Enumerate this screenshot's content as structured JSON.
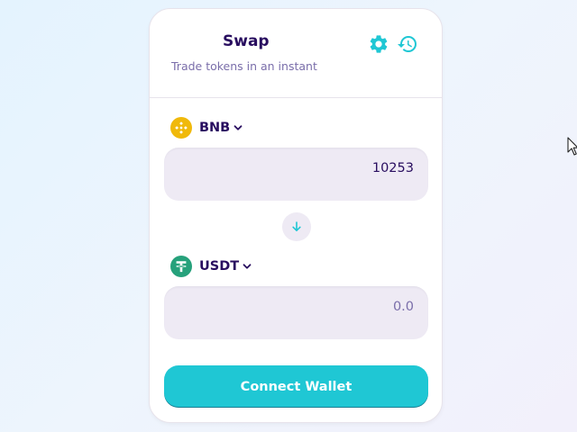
{
  "swap": {
    "title": "Swap",
    "subtitle": "Trade tokens in an instant",
    "header_icons": [
      "gear-icon",
      "history-icon"
    ]
  },
  "from_token": {
    "symbol": "BNB",
    "logo": "bnb-logo",
    "amount": "10253",
    "placeholder": "0.0"
  },
  "to_token": {
    "symbol": "USDT",
    "logo": "usdt-logo",
    "amount": "",
    "placeholder": "0.0"
  },
  "switch_icon": "arrow-down-icon",
  "connect_button": {
    "label": "Connect Wallet"
  },
  "colors": {
    "accent": "#1fc7d4",
    "text_primary": "#280d5f",
    "text_secondary": "#7a6eaa",
    "input_bg": "#eeeaf4",
    "bnb": "#f0b90b",
    "usdt": "#26a17b"
  }
}
